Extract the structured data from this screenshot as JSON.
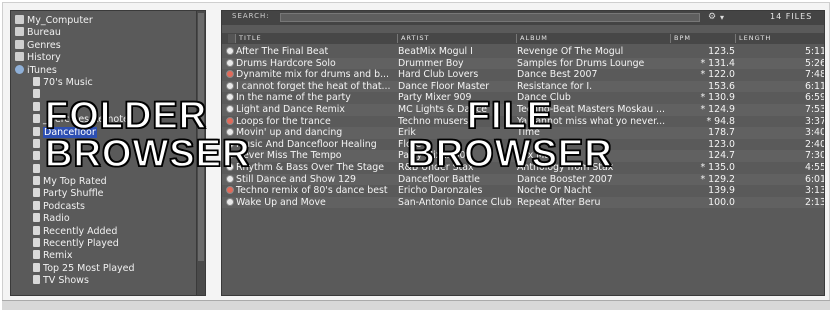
{
  "folders": [
    {
      "label": "My_Computer",
      "icon": "computer-icon",
      "child": false
    },
    {
      "label": "Bureau",
      "icon": "desktop-icon",
      "child": false
    },
    {
      "label": "Genres",
      "icon": "list-icon",
      "child": false
    },
    {
      "label": "History",
      "icon": "history-icon",
      "child": false
    },
    {
      "label": "iTunes",
      "icon": "itunes-icon",
      "child": false
    },
    {
      "label": "70's Music",
      "icon": "playlist-icon",
      "child": true
    },
    {
      "label": "",
      "icon": "playlist-icon",
      "child": true
    },
    {
      "label": "",
      "icon": "playlist-icon",
      "child": true
    },
    {
      "label": "_Hercules Remote",
      "icon": "playlist-icon",
      "child": true
    },
    {
      "label": "Dancefloor",
      "icon": "playlist-icon",
      "child": true,
      "selected": true
    },
    {
      "label": "",
      "icon": "playlist-icon",
      "child": true
    },
    {
      "label": "",
      "icon": "playlist-icon",
      "child": true
    },
    {
      "label": "",
      "icon": "playlist-icon",
      "child": true
    },
    {
      "label": "My Top Rated",
      "icon": "playlist-icon",
      "child": true
    },
    {
      "label": "Party Shuffle",
      "icon": "playlist-icon",
      "child": true
    },
    {
      "label": "Podcasts",
      "icon": "playlist-icon",
      "child": true
    },
    {
      "label": "Radio",
      "icon": "playlist-icon",
      "child": true
    },
    {
      "label": "Recently Added",
      "icon": "playlist-icon",
      "child": true
    },
    {
      "label": "Recently Played",
      "icon": "playlist-icon",
      "child": true
    },
    {
      "label": "Remix",
      "icon": "playlist-icon",
      "child": true
    },
    {
      "label": "Top 25 Most Played",
      "icon": "playlist-icon",
      "child": true
    },
    {
      "label": "TV Shows",
      "icon": "playlist-icon",
      "child": true
    }
  ],
  "search": {
    "label": "SEARCH:",
    "value": "",
    "file_count": "14 FILES"
  },
  "columns": {
    "title": "TITLE",
    "artist": "ARTIST",
    "album": "ALBUM",
    "bpm": "BPM",
    "length": "LENGTH"
  },
  "tracks": [
    {
      "title": "After The Final Beat",
      "artist": "BeatMix Mogul I",
      "album": "Revenge Of The Mogul",
      "bpm": "123.5",
      "length": "5:11",
      "red": false
    },
    {
      "title": "Drums Hardcore Solo",
      "artist": "Drummer Boy",
      "album": "Samples for Drums Lounge",
      "bpm": "* 131.4",
      "length": "5:26",
      "red": false
    },
    {
      "title": "Dynamite mix for drums and b...",
      "artist": "Hard Club Lovers",
      "album": "Dance Best 2007",
      "bpm": "* 122.0",
      "length": "7:48",
      "red": true
    },
    {
      "title": "I cannot forget the heat of that...",
      "artist": "Dance Floor Master",
      "album": "Resistance for I.",
      "bpm": "153.6",
      "length": "6:11",
      "red": false
    },
    {
      "title": "In the name of the party",
      "artist": "Party Mixer 909",
      "album": "Dance Club",
      "bpm": "* 130.9",
      "length": "6:59",
      "red": false
    },
    {
      "title": "Light and Dance Remix",
      "artist": "MC Lights & Dance",
      "album": "Techno-Beat Masters Moskau ...",
      "bpm": "* 124.9",
      "length": "7:53",
      "red": false
    },
    {
      "title": "Loops for the trance",
      "artist": "Techno musers",
      "album": "Ya cannot miss what yo never...",
      "bpm": "* 94.8",
      "length": "3:37",
      "red": true
    },
    {
      "title": "Movin' up and dancing",
      "artist": "Erik",
      "album": "Time",
      "bpm": "178.7",
      "length": "3:40",
      "red": false
    },
    {
      "title": "Music And Dancefloor Healing",
      "artist": "Flore",
      "album": "",
      "bpm": "123.0",
      "length": "2:40",
      "red": false
    },
    {
      "title": "Never Miss The Tempo",
      "artist": "Party Mixer 909",
      "album": "Mix Max",
      "bpm": "124.7",
      "length": "7:30",
      "red": false
    },
    {
      "title": "Rhythm & Bass Over The Stage",
      "artist": "R&B Under Stax",
      "album": "Anthology from Stax",
      "bpm": "* 135.0",
      "length": "4:55",
      "red": false
    },
    {
      "title": "Still Dance and Show 129",
      "artist": "Dancefloor Battle",
      "album": "Dance Booster 2007",
      "bpm": "* 129.2",
      "length": "6:01",
      "red": false
    },
    {
      "title": "Techno remix of 80's dance best",
      "artist": "Ericho Daronzales",
      "album": "Noche Or Nacht",
      "bpm": "139.9",
      "length": "3:13",
      "red": true
    },
    {
      "title": "Wake Up and Move",
      "artist": "San-Antonio Dance Club",
      "album": "Repeat After Beru",
      "bpm": "100.0",
      "length": "2:13",
      "red": false
    }
  ],
  "overlay": {
    "folder_line1": "FOLDER",
    "folder_line2": "BROWSER",
    "file_line1": "FILE",
    "file_line2": "BROWSER"
  }
}
